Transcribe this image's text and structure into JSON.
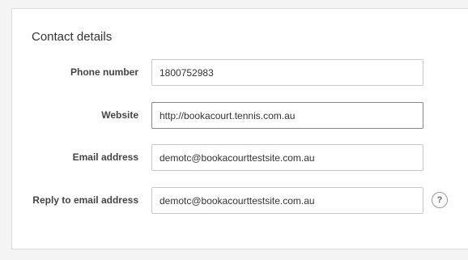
{
  "section": {
    "title": "Contact details"
  },
  "fields": {
    "phone": {
      "label": "Phone number",
      "value": "1800752983"
    },
    "website": {
      "label": "Website",
      "value": "http://bookacourt.tennis.com.au"
    },
    "email": {
      "label": "Email address",
      "value": "demotc@bookacourttestsite.com.au"
    },
    "reply_email": {
      "label": "Reply to email address",
      "value": "demotc@bookacourttestsite.com.au",
      "help_icon": "question-mark-icon",
      "help_glyph": "?"
    }
  }
}
